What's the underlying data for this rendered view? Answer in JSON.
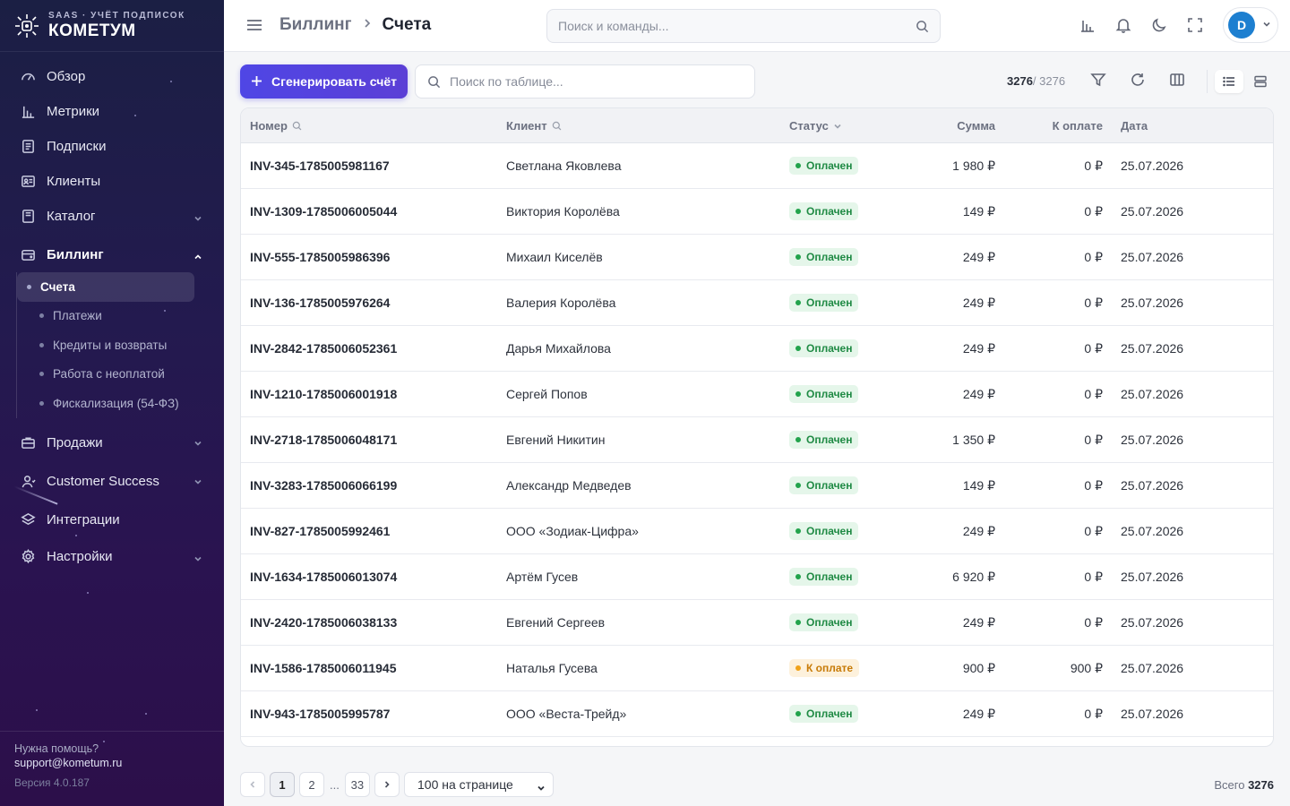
{
  "brand": {
    "tag": "SAAS · УЧЁТ ПОДПИСОК",
    "name": "КОМЕТУМ"
  },
  "nav": {
    "items_top": [
      {
        "label": "Обзор",
        "icon": "gauge-icon"
      },
      {
        "label": "Метрики",
        "icon": "bar-chart-icon"
      },
      {
        "label": "Подписки",
        "icon": "document-icon"
      },
      {
        "label": "Клиенты",
        "icon": "id-card-icon"
      },
      {
        "label": "Каталог",
        "icon": "catalog-icon"
      }
    ],
    "billing": {
      "label": "Биллинг",
      "sub": [
        "Счета",
        "Платежи",
        "Кредиты и возвраты",
        "Работа с неоплатой",
        "Фискализация (54-ФЗ)"
      ]
    },
    "items_bottom": [
      {
        "label": "Продажи",
        "icon": "briefcase-icon"
      },
      {
        "label": "Customer Success",
        "icon": "user-icon"
      },
      {
        "label": "Интеграции",
        "icon": "layers-icon"
      },
      {
        "label": "Настройки",
        "icon": "gear-icon"
      }
    ]
  },
  "footer": {
    "help": "Нужна помощь?",
    "email": "support@kometum.ru",
    "version": "Версия 4.0.187"
  },
  "topbar": {
    "crumb1": "Биллинг",
    "crumb2": "Счета",
    "search_placeholder": "Поиск и команды...",
    "avatar_letter": "D"
  },
  "toolbar": {
    "generate_label": "Сгенерировать счёт",
    "table_search_placeholder": "Поиск по таблице...",
    "count_shown": "3276",
    "count_total": "/ 3276"
  },
  "table": {
    "headers": {
      "number": "Номер",
      "client": "Клиент",
      "status": "Статус",
      "sum": "Сумма",
      "due": "К оплате",
      "date": "Дата"
    },
    "rows": [
      {
        "number": "INV-345-1785005981167",
        "client": "Светлана Яковлева",
        "status": "Оплачен",
        "status_type": "paid",
        "sum": "1 980 ₽",
        "due": "0 ₽",
        "date": "25.07.2026"
      },
      {
        "number": "INV-1309-1785006005044",
        "client": "Виктория Королёва",
        "status": "Оплачен",
        "status_type": "paid",
        "sum": "149 ₽",
        "due": "0 ₽",
        "date": "25.07.2026"
      },
      {
        "number": "INV-555-1785005986396",
        "client": "Михаил Киселёв",
        "status": "Оплачен",
        "status_type": "paid",
        "sum": "249 ₽",
        "due": "0 ₽",
        "date": "25.07.2026"
      },
      {
        "number": "INV-136-1785005976264",
        "client": "Валерия Королёва",
        "status": "Оплачен",
        "status_type": "paid",
        "sum": "249 ₽",
        "due": "0 ₽",
        "date": "25.07.2026"
      },
      {
        "number": "INV-2842-1785006052361",
        "client": "Дарья Михайлова",
        "status": "Оплачен",
        "status_type": "paid",
        "sum": "249 ₽",
        "due": "0 ₽",
        "date": "25.07.2026"
      },
      {
        "number": "INV-1210-1785006001918",
        "client": "Сергей Попов",
        "status": "Оплачен",
        "status_type": "paid",
        "sum": "249 ₽",
        "due": "0 ₽",
        "date": "25.07.2026"
      },
      {
        "number": "INV-2718-1785006048171",
        "client": "Евгений Никитин",
        "status": "Оплачен",
        "status_type": "paid",
        "sum": "1 350 ₽",
        "due": "0 ₽",
        "date": "25.07.2026"
      },
      {
        "number": "INV-3283-1785006066199",
        "client": "Александр Медведев",
        "status": "Оплачен",
        "status_type": "paid",
        "sum": "149 ₽",
        "due": "0 ₽",
        "date": "25.07.2026"
      },
      {
        "number": "INV-827-1785005992461",
        "client": "ООО «Зодиак-Цифра»",
        "status": "Оплачен",
        "status_type": "paid",
        "sum": "249 ₽",
        "due": "0 ₽",
        "date": "25.07.2026"
      },
      {
        "number": "INV-1634-1785006013074",
        "client": "Артём Гусев",
        "status": "Оплачен",
        "status_type": "paid",
        "sum": "6 920 ₽",
        "due": "0 ₽",
        "date": "25.07.2026"
      },
      {
        "number": "INV-2420-1785006038133",
        "client": "Евгений Сергеев",
        "status": "Оплачен",
        "status_type": "paid",
        "sum": "249 ₽",
        "due": "0 ₽",
        "date": "25.07.2026"
      },
      {
        "number": "INV-1586-1785006011945",
        "client": "Наталья Гусева",
        "status": "К оплате",
        "status_type": "due",
        "sum": "900 ₽",
        "due": "900 ₽",
        "date": "25.07.2026"
      },
      {
        "number": "INV-943-1785005995787",
        "client": "ООО «Веста-Трейд»",
        "status": "Оплачен",
        "status_type": "paid",
        "sum": "249 ₽",
        "due": "0 ₽",
        "date": "25.07.2026"
      }
    ]
  },
  "pagination": {
    "pages": [
      "1",
      "2",
      "33"
    ],
    "ellipsis": "...",
    "per_page": "100 на странице",
    "total_label": "Всего",
    "total": "3276"
  },
  "colors": {
    "accent": "#4f46e5",
    "paid": "#22a34c",
    "due": "#f0a21a",
    "sidebar": "#231a4f"
  }
}
